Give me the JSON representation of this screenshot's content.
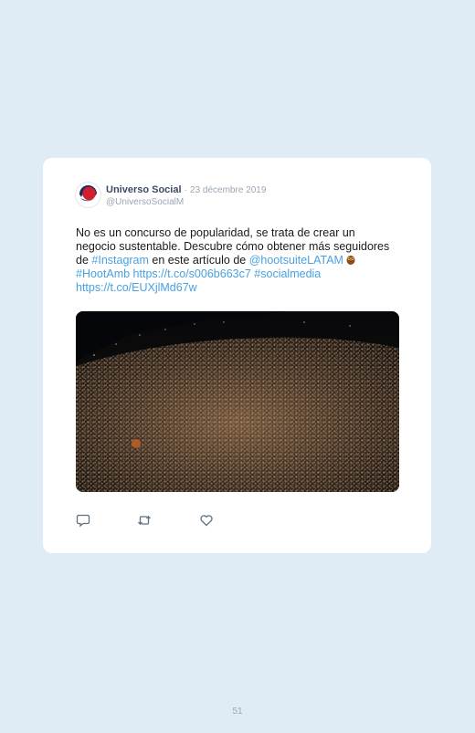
{
  "tweet": {
    "author_name": "Universo Social",
    "separator": "·",
    "date": "23 décembre 2019",
    "handle": "@UniversoSocialM",
    "text": {
      "line1": "No es un concurso de popularidad, se trata de crear un negocio sustentable. Descubre cómo obtener más seguidores de ",
      "hashtag_instagram": "#Instagram",
      "line2": " en este artículo de ",
      "mention": "@hootsuiteLATAM",
      "hashtag_hootamb": "#HootAmb",
      "link1": "https://t.co/s006b663c7",
      "hashtag_socialmedia": "#socialmedia",
      "link2": "https://t.co/EUXjlMd67w"
    },
    "media_description_icon": "concert-crowd-photo",
    "actions": {
      "reply_icon": "reply-icon",
      "retweet_icon": "retweet-icon",
      "like_icon": "heart-icon"
    }
  },
  "colors": {
    "background": "#dfecf5",
    "link": "#4aa1e0",
    "avatar_red": "#d02030",
    "avatar_navy": "#1d2c5e"
  },
  "page_number": "51"
}
